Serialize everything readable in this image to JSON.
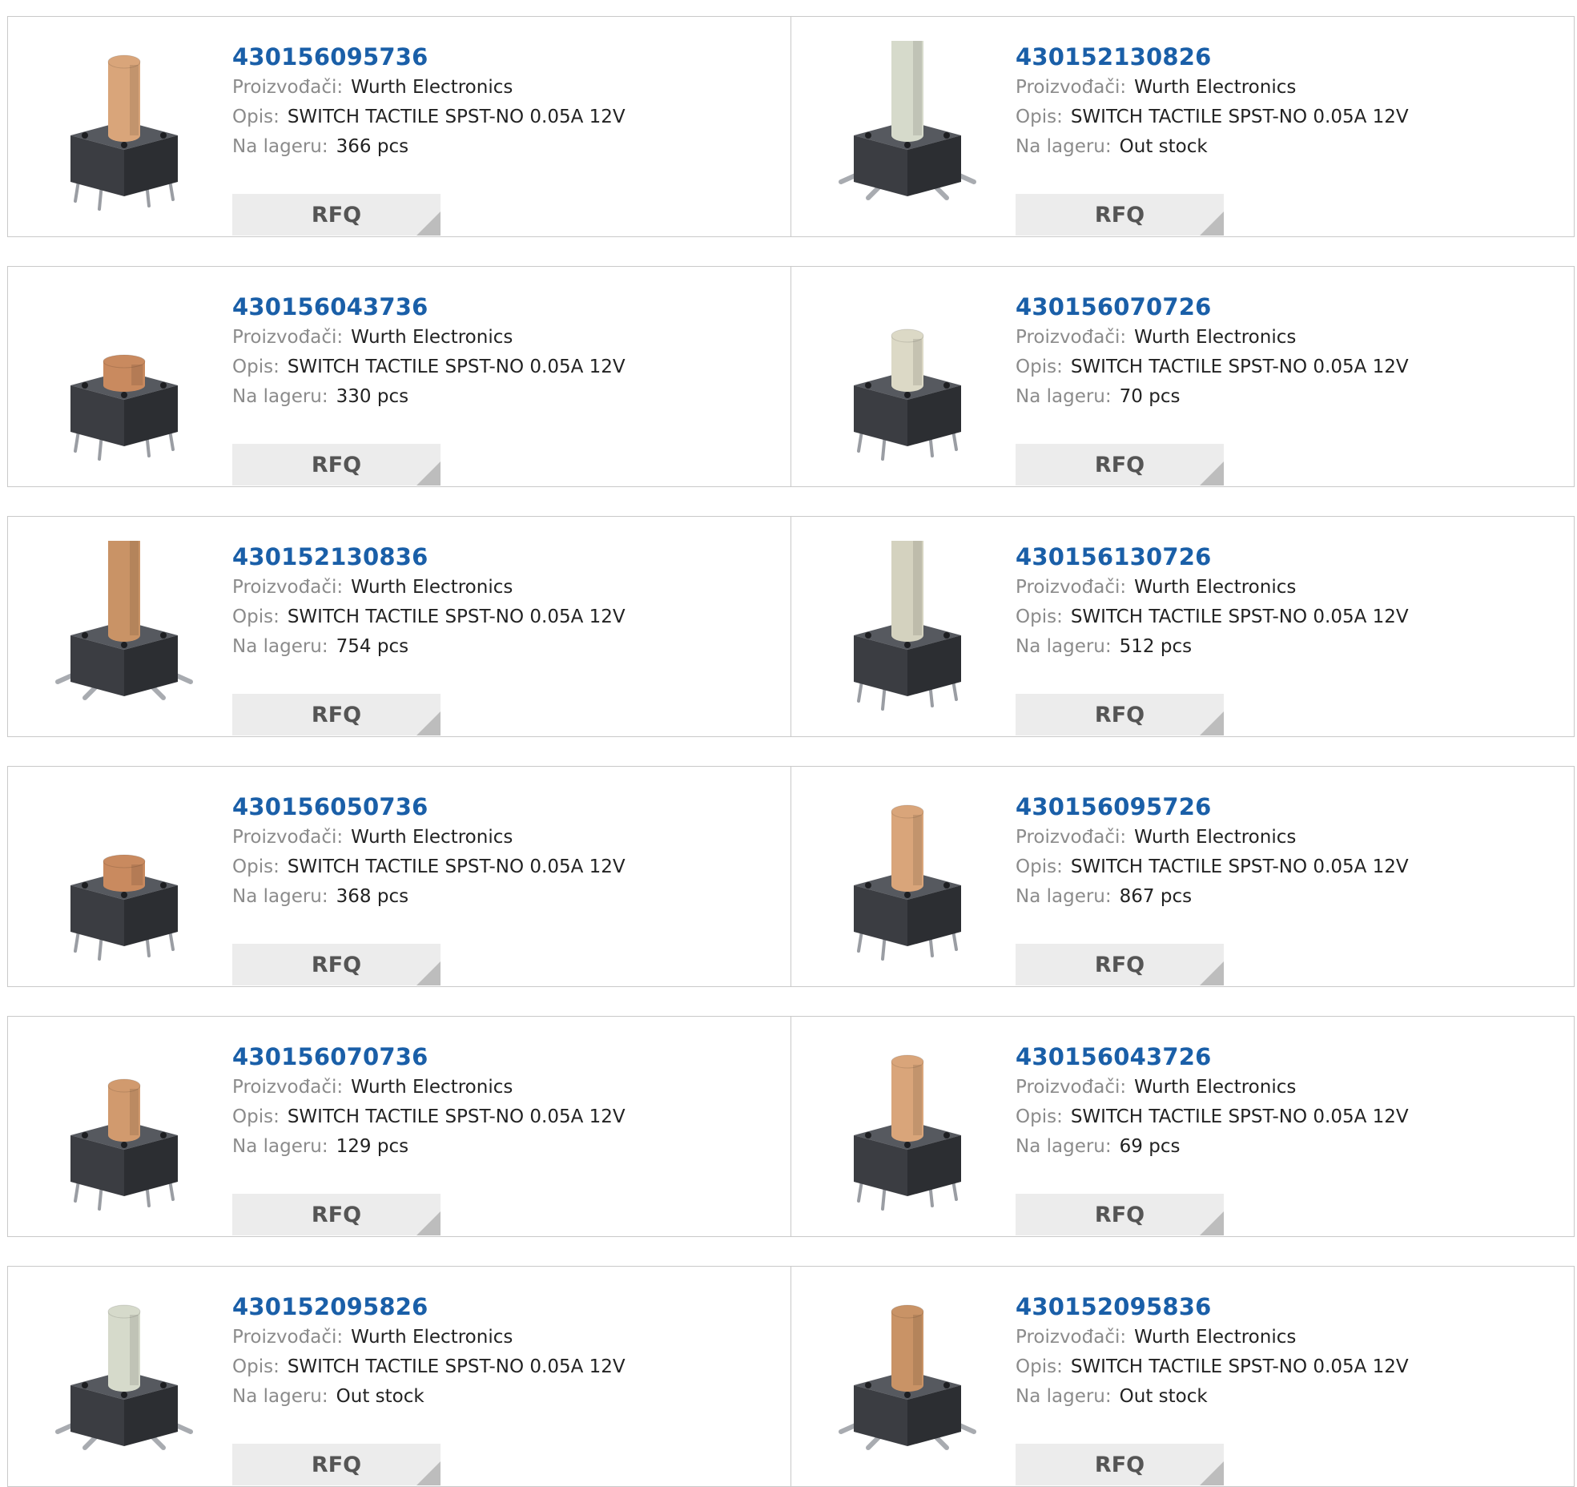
{
  "labels": {
    "manufacturer": "Proizvođači:",
    "description": "Opis:",
    "stock": "Na lageru:",
    "rfq": "RFQ"
  },
  "products": [
    {
      "part": "430156095736",
      "manufacturer": "Wurth Electronics",
      "description": "SWITCH TACTILE SPST-NO 0.05A 12V",
      "stock": "366 pcs",
      "image": {
        "icon": "tactile-switch-icon",
        "actuator_color": "#d9a57a",
        "actuator": "tall",
        "legs": "through-hole"
      }
    },
    {
      "part": "430152130826",
      "manufacturer": "Wurth Electronics",
      "description": "SWITCH TACTILE SPST-NO 0.05A 12V",
      "stock": "Out stock",
      "image": {
        "icon": "tactile-switch-icon",
        "actuator_color": "#d6dacb",
        "actuator": "extra-tall",
        "legs": "smd"
      }
    },
    {
      "part": "430156043736",
      "manufacturer": "Wurth Electronics",
      "description": "SWITCH TACTILE SPST-NO 0.05A 12V",
      "stock": "330 pcs",
      "image": {
        "icon": "tactile-switch-icon",
        "actuator_color": "#c98a5f",
        "actuator": "short",
        "legs": "through-hole"
      }
    },
    {
      "part": "430156070726",
      "manufacturer": "Wurth Electronics",
      "description": "SWITCH TACTILE SPST-NO 0.05A 12V",
      "stock": "70 pcs",
      "image": {
        "icon": "tactile-switch-icon",
        "actuator_color": "#dcd9c6",
        "actuator": "medium",
        "legs": "through-hole"
      }
    },
    {
      "part": "430152130836",
      "manufacturer": "Wurth Electronics",
      "description": "SWITCH TACTILE SPST-NO 0.05A 12V",
      "stock": "754 pcs",
      "image": {
        "icon": "tactile-switch-icon",
        "actuator_color": "#c99366",
        "actuator": "extra-tall",
        "legs": "smd"
      }
    },
    {
      "part": "430156130726",
      "manufacturer": "Wurth Electronics",
      "description": "SWITCH TACTILE SPST-NO 0.05A 12V",
      "stock": "512 pcs",
      "image": {
        "icon": "tactile-switch-icon",
        "actuator_color": "#d4d2bf",
        "actuator": "extra-tall",
        "legs": "through-hole"
      }
    },
    {
      "part": "430156050736",
      "manufacturer": "Wurth Electronics",
      "description": "SWITCH TACTILE SPST-NO 0.05A 12V",
      "stock": "368 pcs",
      "image": {
        "icon": "tactile-switch-icon",
        "actuator_color": "#c98a5f",
        "actuator": "short",
        "legs": "through-hole"
      }
    },
    {
      "part": "430156095726",
      "manufacturer": "Wurth Electronics",
      "description": "SWITCH TACTILE SPST-NO 0.05A 12V",
      "stock": "867 pcs",
      "image": {
        "icon": "tactile-switch-icon",
        "actuator_color": "#d9a57a",
        "actuator": "tall",
        "legs": "through-hole"
      }
    },
    {
      "part": "430156070736",
      "manufacturer": "Wurth Electronics",
      "description": "SWITCH TACTILE SPST-NO 0.05A 12V",
      "stock": "129 pcs",
      "image": {
        "icon": "tactile-switch-icon",
        "actuator_color": "#d19a6e",
        "actuator": "medium",
        "legs": "through-hole"
      }
    },
    {
      "part": "430156043726",
      "manufacturer": "Wurth Electronics",
      "description": "SWITCH TACTILE SPST-NO 0.05A 12V",
      "stock": "69 pcs",
      "image": {
        "icon": "tactile-switch-icon",
        "actuator_color": "#d9a57a",
        "actuator": "tall",
        "legs": "through-hole"
      }
    },
    {
      "part": "430152095826",
      "manufacturer": "Wurth Electronics",
      "description": "SWITCH TACTILE SPST-NO 0.05A 12V",
      "stock": "Out stock",
      "image": {
        "icon": "tactile-switch-icon",
        "actuator_color": "#d6dacb",
        "actuator": "tall",
        "legs": "smd"
      }
    },
    {
      "part": "430152095836",
      "manufacturer": "Wurth Electronics",
      "description": "SWITCH TACTILE SPST-NO 0.05A 12V",
      "stock": "Out stock",
      "image": {
        "icon": "tactile-switch-icon",
        "actuator_color": "#c99366",
        "actuator": "tall",
        "legs": "smd"
      }
    }
  ]
}
